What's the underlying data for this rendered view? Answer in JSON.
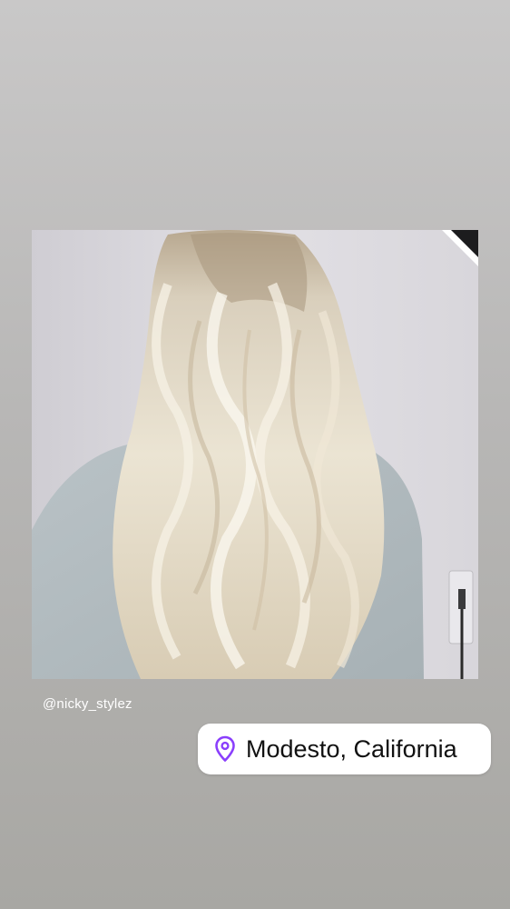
{
  "story": {
    "mention": "@nicky_stylez",
    "location": {
      "label": "Modesto, California",
      "icon": "location-pin-icon",
      "icon_color": "#8a3ffc"
    },
    "photo": {
      "subject": "photo"
    }
  }
}
